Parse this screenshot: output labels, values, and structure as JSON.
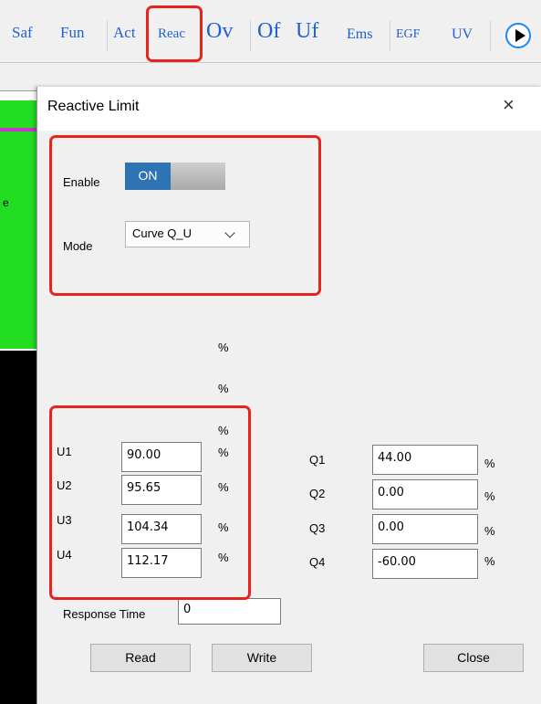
{
  "toolbar": {
    "items": [
      "Saf",
      "Fun",
      "Act",
      "Reac",
      "Ov",
      "Of",
      "Uf",
      "Ems",
      "EGF",
      "UV"
    ]
  },
  "background": {
    "side_text": "e"
  },
  "dialog": {
    "title": "Reactive Limit",
    "close_symbol": "×",
    "enable_label": "Enable",
    "toggle_text": "ON",
    "mode_label": "Mode",
    "mode_value": "Curve Q_U",
    "percent_sign": "%",
    "u_labels": [
      "U1",
      "U2",
      "U3",
      "U4"
    ],
    "u_values": [
      "90.00",
      "95.65",
      "104.34",
      "112.17"
    ],
    "q_labels": [
      "Q1",
      "Q2",
      "Q3",
      "Q4"
    ],
    "q_values": [
      "44.00",
      "0.00",
      "0.00",
      "-60.00"
    ],
    "response_time_label": "Response Time",
    "response_time_value": "0",
    "read_label": "Read",
    "write_label": "Write",
    "close_label": "Close"
  },
  "colors": {
    "annotation": "#e8231e",
    "toggle_on": "#2e74b5",
    "toolbar_text": "#1f5fd6",
    "background_green": "#22dd22"
  },
  "icons": {
    "close": "close-icon",
    "play": "play-icon",
    "dropdown": "chevron-down-icon"
  }
}
